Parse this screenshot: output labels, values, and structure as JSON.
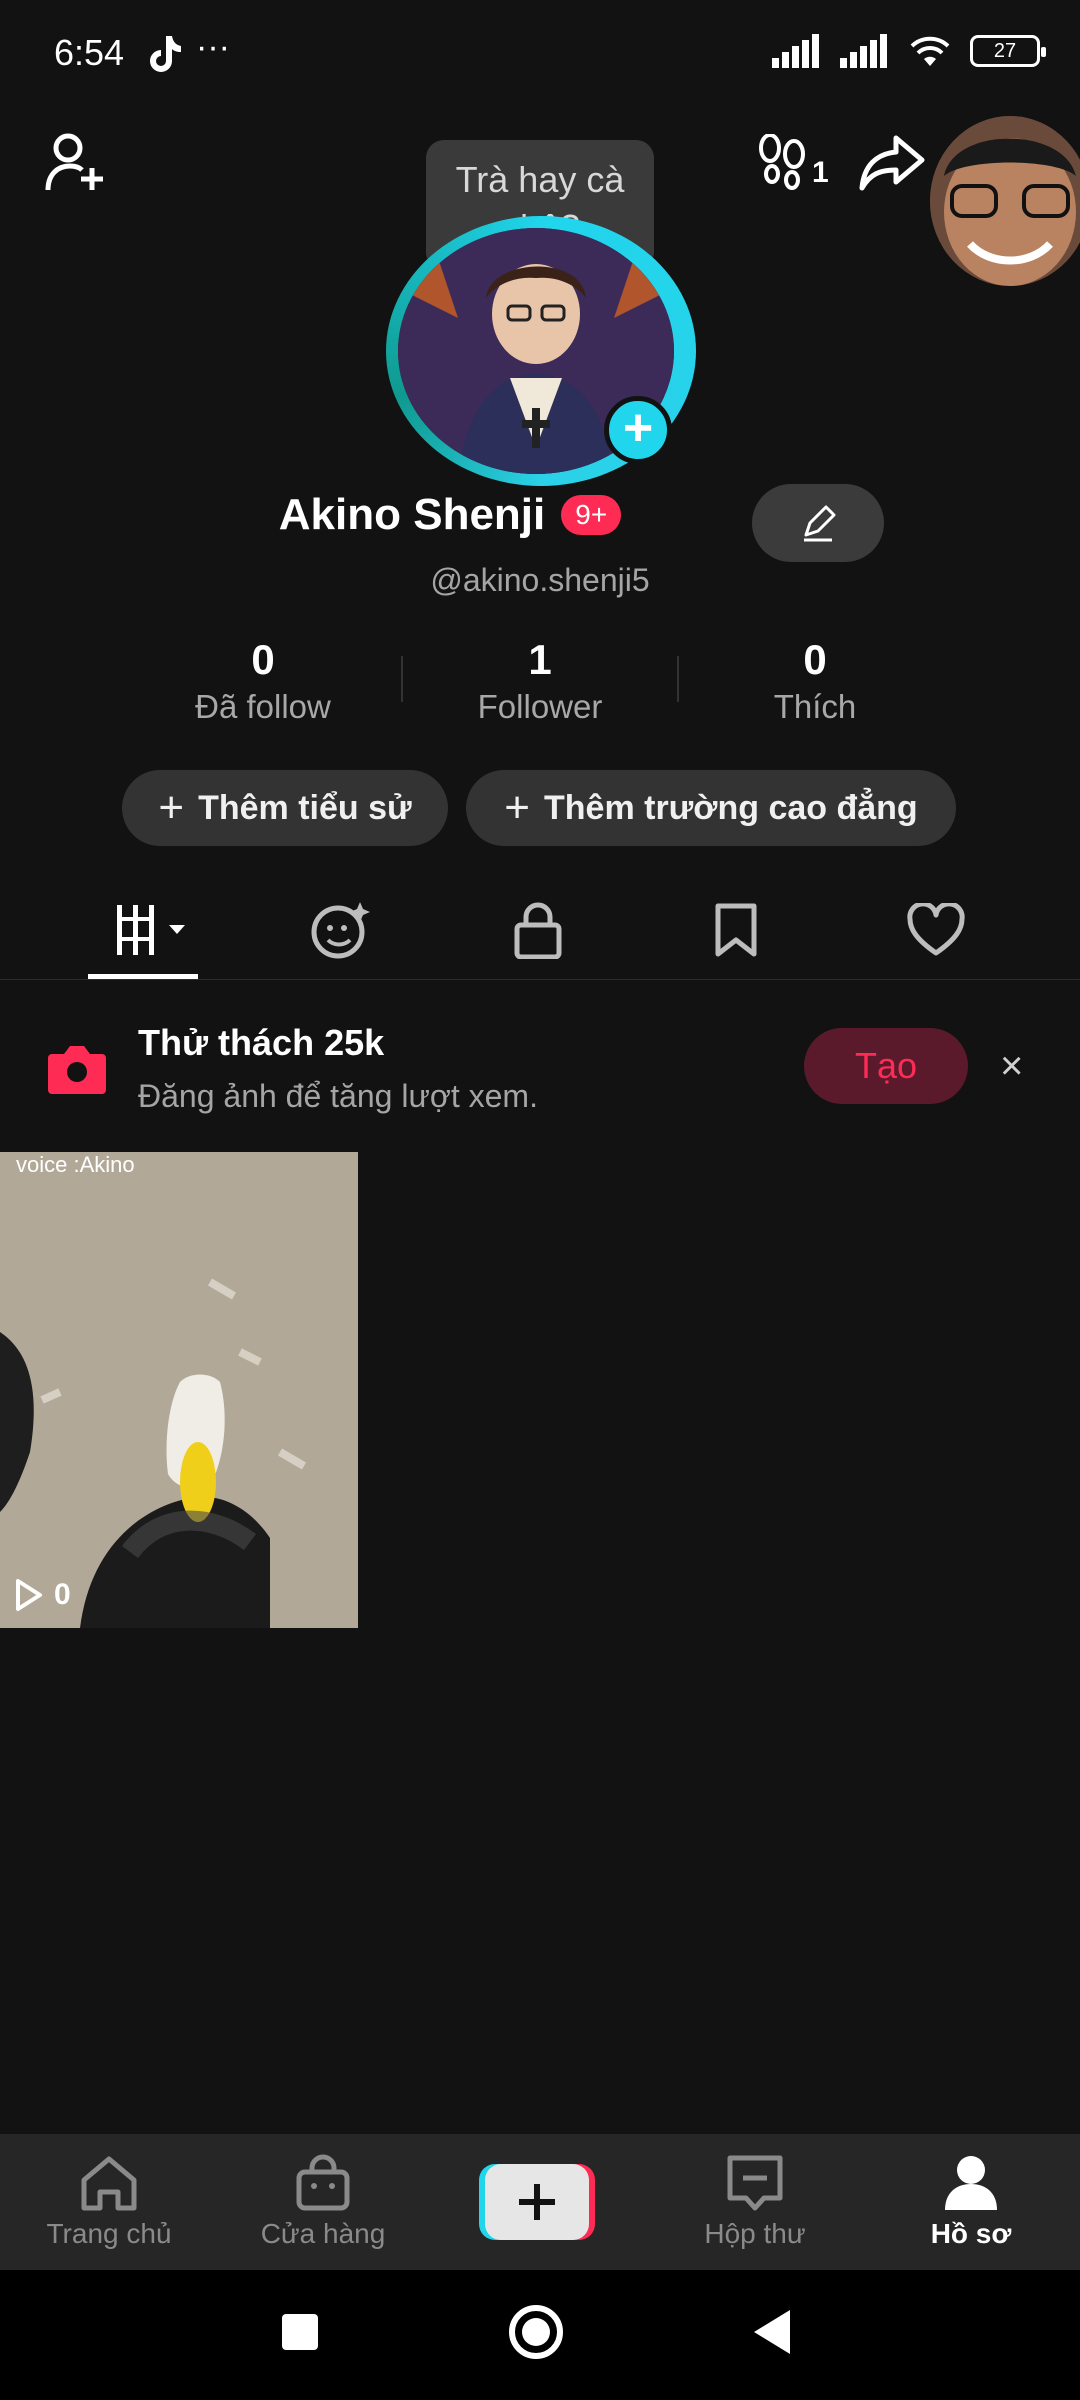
{
  "status": {
    "time": "6:54",
    "battery": "27",
    "more": "···"
  },
  "header": {
    "tooltip": "Trà hay cà phê?",
    "footprint_count": "1"
  },
  "profile": {
    "name": "Akino Shenji",
    "badge": "9+",
    "username": "@akino.shenji5",
    "stats": [
      {
        "value": "0",
        "label": "Đã follow"
      },
      {
        "value": "1",
        "label": "Follower"
      },
      {
        "value": "0",
        "label": "Thích"
      }
    ],
    "add_bio": "Thêm tiểu sử",
    "add_school": "Thêm trường cao đẳng"
  },
  "challenge": {
    "title": "Thử thách 25k",
    "subtitle": "Đăng ảnh để tăng lượt xem.",
    "create_label": "Tạo",
    "close": "×"
  },
  "videos": [
    {
      "caption": "voice :Akino",
      "views": "0"
    }
  ],
  "bottom_nav": [
    {
      "label": "Trang chủ",
      "icon": "home-icon"
    },
    {
      "label": "Cửa hàng",
      "icon": "shop-icon"
    },
    {
      "label": "",
      "icon": "create-icon"
    },
    {
      "label": "Hộp thư",
      "icon": "inbox-icon"
    },
    {
      "label": "Hồ sơ",
      "icon": "profile-icon"
    }
  ],
  "colors": {
    "accent": "#fe2c55",
    "cyan": "#20d5ec",
    "bg": "#121212"
  }
}
